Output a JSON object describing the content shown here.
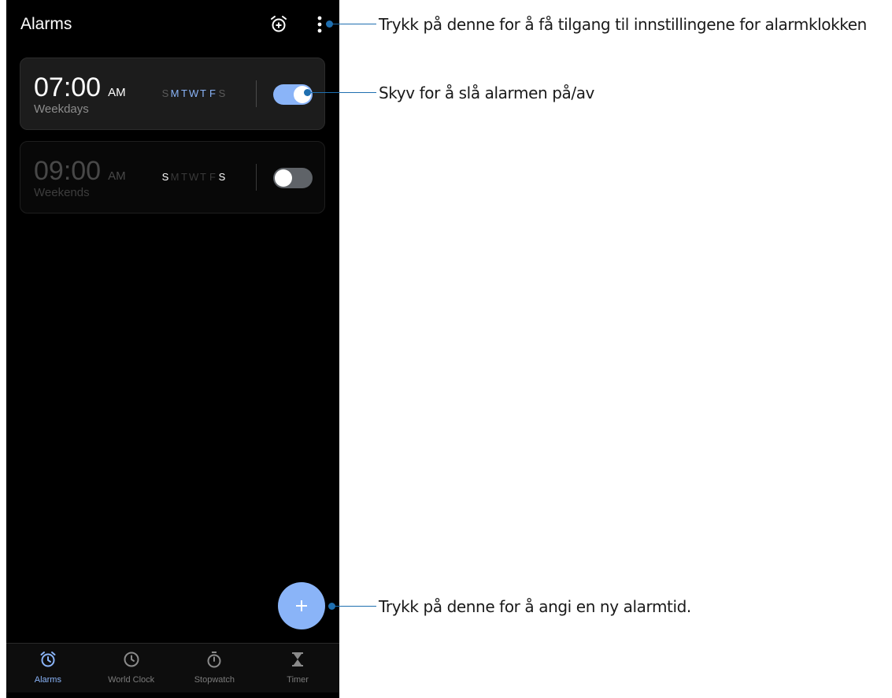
{
  "header": {
    "title": "Alarms"
  },
  "alarms": [
    {
      "time": "07:00",
      "ampm": "AM",
      "label": "Weekdays",
      "enabled": true,
      "days": [
        "S",
        "M",
        "T",
        "W",
        "T",
        "F",
        "S"
      ]
    },
    {
      "time": "09:00",
      "ampm": "AM",
      "label": "Weekends",
      "enabled": false,
      "days": [
        "S",
        "M",
        "T",
        "W",
        "T",
        "F",
        "S"
      ]
    }
  ],
  "bottom_nav": {
    "items": [
      {
        "label": "Alarms",
        "icon": "alarm-clock-icon",
        "active": true
      },
      {
        "label": "World Clock",
        "icon": "clock-icon",
        "active": false
      },
      {
        "label": "Stopwatch",
        "icon": "stopwatch-icon",
        "active": false
      },
      {
        "label": "Timer",
        "icon": "hourglass-icon",
        "active": false
      }
    ]
  },
  "callouts": {
    "settings": "Trykk på denne for å få tilgang til innstillingene for alarmklokken",
    "toggle": "Skyv for å slå alarmen på/av",
    "add": "Trykk på denne for å angi en ny alarmtid."
  },
  "colors": {
    "accent": "#8ab4f8",
    "callout": "#1f6fb0",
    "background": "#000000"
  }
}
